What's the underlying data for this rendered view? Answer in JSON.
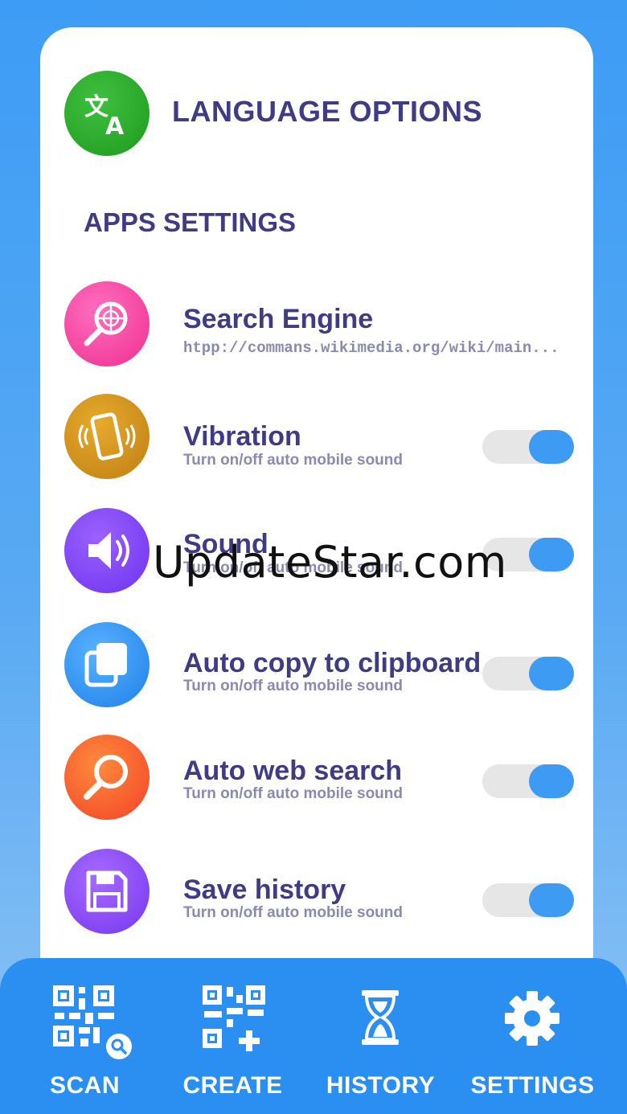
{
  "language": {
    "title": "LANGUAGE OPTIONS",
    "icon": "translate-icon",
    "color": "#23a623"
  },
  "section_title": "APPS SETTINGS",
  "rows": [
    {
      "title": "Search Engine",
      "subtitle": "htpp://commans.wikimedia.org/wiki/main...",
      "icon": "globe-search-icon",
      "color": "#f23c9a"
    },
    {
      "title": "Vibration",
      "subtitle": "Turn on/off auto mobile sound",
      "icon": "vibration-phone-icon",
      "color": "#cf8d19",
      "toggle": true
    },
    {
      "title": "Sound",
      "subtitle": "Turn on/off auto mobile sound",
      "icon": "speaker-icon",
      "color": "#7a3df0",
      "toggle": true
    },
    {
      "title": "Auto copy to clipboard",
      "subtitle": "Turn on/off auto mobile sound",
      "icon": "copy-icon",
      "color": "#2f8ff2",
      "toggle": true
    },
    {
      "title": "Auto web search",
      "subtitle": "Turn on/off auto mobile sound",
      "icon": "magnifier-icon",
      "color": "#f25a2c",
      "toggle": true
    },
    {
      "title": "Save history",
      "subtitle": "Turn on/off auto mobile sound",
      "icon": "floppy-disk-icon",
      "color": "#8a45f0",
      "toggle": true
    }
  ],
  "watermark": "UpdateStar.com",
  "nav": [
    {
      "label": "SCAN",
      "icon": "qr-scan-icon"
    },
    {
      "label": "CREATE",
      "icon": "qr-create-icon"
    },
    {
      "label": "HISTORY",
      "icon": "hourglass-icon"
    },
    {
      "label": "SETTINGS",
      "icon": "gear-icon"
    }
  ],
  "accent": "#3d9bf4"
}
